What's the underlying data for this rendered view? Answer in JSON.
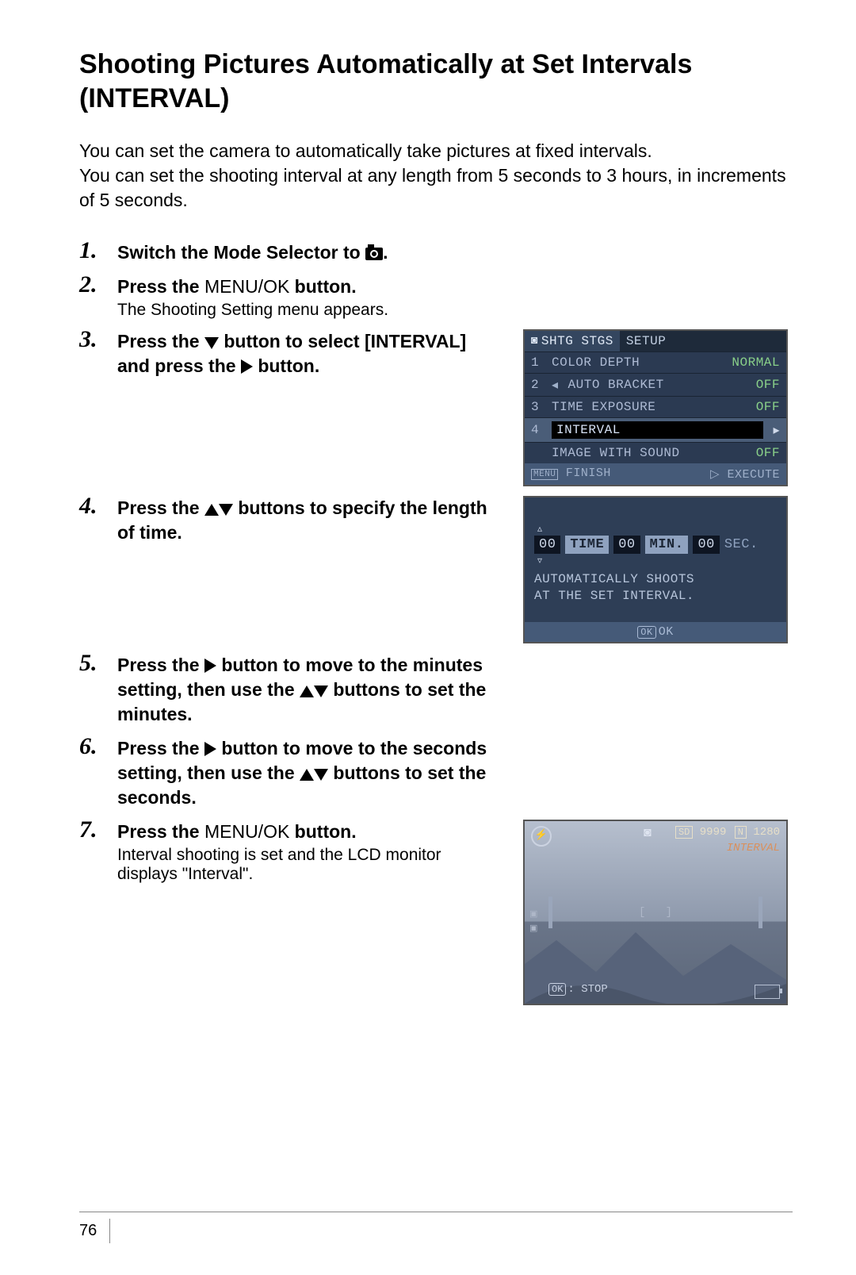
{
  "title": "Shooting Pictures Automatically at Set Intervals (INTERVAL)",
  "intro_p1": "You can set the camera to automatically take pictures at fixed intervals.",
  "intro_p2": "You can set the shooting interval at any length from 5 seconds to 3 hours, in increments of 5 seconds.",
  "steps": {
    "s1_a": "Switch the Mode Selector to ",
    "s1_b": ".",
    "s2_a": "Press the ",
    "s2_menuok": "MENU/OK",
    "s2_b": " button.",
    "s2_sub": "The Shooting Setting menu appears.",
    "s3_a": "Press the ",
    "s3_b": " button to select [INTERVAL] and press the ",
    "s3_c": " button.",
    "s4_a": "Press the ",
    "s4_b": " buttons to specify the length of time.",
    "s5_a": "Press the ",
    "s5_b": " button to move to the minutes setting, then use the ",
    "s5_c": " buttons to set the minutes.",
    "s6_a": "Press the ",
    "s6_b": " button to move to the seconds setting, then use the ",
    "s6_c": " buttons to set the seconds.",
    "s7_a": "Press the ",
    "s7_menuok": "MENU/OK",
    "s7_b": " button.",
    "s7_sub": "Interval shooting is set and the LCD monitor displays \"Interval\"."
  },
  "lcd1": {
    "tab1": "SHTG STGS",
    "tab2": "SETUP",
    "rows": [
      {
        "n": "1",
        "label": "COLOR DEPTH",
        "val": "NORMAL"
      },
      {
        "n": "2",
        "label": "AUTO BRACKET",
        "val": "OFF",
        "pre": "◂"
      },
      {
        "n": "3",
        "label": "TIME EXPOSURE",
        "val": "OFF"
      },
      {
        "n": "4",
        "label": "INTERVAL",
        "val": "▸",
        "sel": true
      },
      {
        "n": "",
        "label": "IMAGE WITH SOUND",
        "val": "OFF"
      }
    ],
    "footerL": "FINISH",
    "footerLpre": "MENU",
    "footerR": "▷ EXECUTE"
  },
  "lcd2": {
    "hrs": "00",
    "tTime": "TIME",
    "min": "00",
    "tMin": "MIN.",
    "sec": "00",
    "tSec": "SEC.",
    "note1": "AUTOMATICALLY SHOOTS",
    "note2": "AT THE SET INTERVAL.",
    "ok": "OK"
  },
  "lcd3": {
    "sd": "SD",
    "shots": "9999",
    "n": "N",
    "res": "1280",
    "interval": "INTERVAL",
    "ok": "OK",
    "stop": "STOP"
  },
  "page_number": "76"
}
